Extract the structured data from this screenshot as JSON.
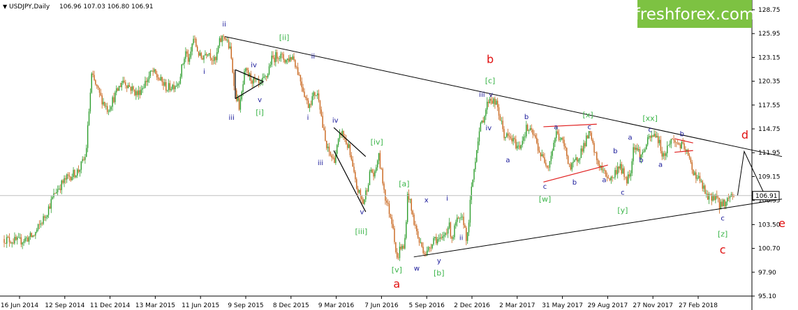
{
  "header": {
    "symbol": "USDJPY,Daily",
    "ohlc": "106.96 107.03 106.80 106.91"
  },
  "brand": {
    "logo_text": "freshforex.com",
    "bg_color": "#7dc242",
    "text_color": "#ffffff"
  },
  "colors": {
    "bull": "#2e9e2e",
    "bear": "#c8641a",
    "trend": "#000000",
    "red_line": "#e02020",
    "label_blue": "#1a1a9a",
    "label_green": "#3cb54a",
    "label_red": "#e01010",
    "current_price_bg": "#ffffff"
  },
  "chart_data": {
    "type": "candlestick",
    "ylim": [
      95.1,
      128.75
    ],
    "y_ticks": [
      "128.75",
      "125.95",
      "123.15",
      "120.35",
      "117.55",
      "114.75",
      "111.95",
      "109.15",
      "106.35",
      "103.50",
      "100.70",
      "97.90",
      "95.10"
    ],
    "x_ticks": [
      "16 Jun 2014",
      "12 Sep 2014",
      "11 Dec 2014",
      "13 Mar 2015",
      "11 Jun 2015",
      "9 Sep 2015",
      "8 Dec 2015",
      "9 Mar 2016",
      "7 Jun 2016",
      "5 Sep 2016",
      "2 Dec 2016",
      "2 Mar 2017",
      "31 May 2017",
      "29 Aug 2017",
      "27 Nov 2017",
      "27 Feb 2018"
    ],
    "current_price": 106.91,
    "current_price_label": "106.91",
    "path": [
      [
        0,
        101.8
      ],
      [
        0.02,
        101.5
      ],
      [
        0.04,
        102.2
      ],
      [
        0.055,
        104.5
      ],
      [
        0.07,
        107.5
      ],
      [
        0.085,
        109.0
      ],
      [
        0.1,
        109.8
      ],
      [
        0.11,
        111.5
      ],
      [
        0.118,
        121.0
      ],
      [
        0.13,
        118.5
      ],
      [
        0.14,
        117.0
      ],
      [
        0.16,
        120.5
      ],
      [
        0.18,
        118.8
      ],
      [
        0.2,
        121.5
      ],
      [
        0.22,
        119.5
      ],
      [
        0.235,
        120.2
      ],
      [
        0.245,
        123.8
      ],
      [
        0.25,
        122.5
      ],
      [
        0.255,
        125.5
      ],
      [
        0.265,
        123.0
      ],
      [
        0.275,
        124.0
      ],
      [
        0.285,
        122.5
      ],
      [
        0.29,
        124.8
      ],
      [
        0.297,
        125.8
      ],
      [
        0.305,
        124.0
      ],
      [
        0.312,
        119.0
      ],
      [
        0.318,
        117.2
      ],
      [
        0.325,
        121.5
      ],
      [
        0.335,
        120.5
      ],
      [
        0.345,
        119.8
      ],
      [
        0.355,
        121.0
      ],
      [
        0.36,
        122.8
      ],
      [
        0.37,
        123.5
      ],
      [
        0.38,
        122.8
      ],
      [
        0.39,
        123.3
      ],
      [
        0.4,
        120.5
      ],
      [
        0.41,
        117.5
      ],
      [
        0.42,
        119.0
      ],
      [
        0.425,
        118.5
      ],
      [
        0.43,
        115.0
      ],
      [
        0.435,
        112.5
      ],
      [
        0.445,
        111.0
      ],
      [
        0.455,
        114.5
      ],
      [
        0.465,
        112.5
      ],
      [
        0.475,
        108.0
      ],
      [
        0.485,
        106.0
      ],
      [
        0.495,
        110.0
      ],
      [
        0.5,
        109.0
      ],
      [
        0.505,
        111.8
      ],
      [
        0.515,
        106.5
      ],
      [
        0.525,
        103.5
      ],
      [
        0.53,
        99.2
      ],
      [
        0.535,
        101.0
      ],
      [
        0.54,
        100.5
      ],
      [
        0.545,
        107.5
      ],
      [
        0.55,
        105.0
      ],
      [
        0.56,
        101.5
      ],
      [
        0.57,
        100.0
      ],
      [
        0.58,
        102.0
      ],
      [
        0.59,
        101.5
      ],
      [
        0.6,
        103.5
      ],
      [
        0.605,
        101.8
      ],
      [
        0.61,
        103.8
      ],
      [
        0.62,
        104.0
      ],
      [
        0.625,
        101.5
      ],
      [
        0.63,
        107.0
      ],
      [
        0.64,
        114.0
      ],
      [
        0.655,
        118.5
      ],
      [
        0.665,
        117.5
      ],
      [
        0.675,
        114.0
      ],
      [
        0.685,
        113.5
      ],
      [
        0.695,
        112.5
      ],
      [
        0.705,
        114.8
      ],
      [
        0.715,
        114.0
      ],
      [
        0.725,
        111.5
      ],
      [
        0.735,
        110.5
      ],
      [
        0.745,
        114.3
      ],
      [
        0.755,
        113.0
      ],
      [
        0.765,
        110.0
      ],
      [
        0.775,
        111.5
      ],
      [
        0.79,
        114.2
      ],
      [
        0.8,
        111.0
      ],
      [
        0.81,
        109.5
      ],
      [
        0.82,
        108.8
      ],
      [
        0.83,
        110.5
      ],
      [
        0.84,
        108.8
      ],
      [
        0.845,
        109.5
      ],
      [
        0.85,
        113.0
      ],
      [
        0.86,
        111.5
      ],
      [
        0.87,
        113.5
      ],
      [
        0.88,
        114.2
      ],
      [
        0.89,
        111.5
      ],
      [
        0.9,
        113.5
      ],
      [
        0.91,
        113.0
      ],
      [
        0.92,
        112.3
      ],
      [
        0.93,
        109.8
      ],
      [
        0.94,
        108.5
      ],
      [
        0.95,
        106.5
      ],
      [
        0.96,
        107.0
      ],
      [
        0.965,
        105.8
      ],
      [
        0.975,
        106.2
      ],
      [
        0.98,
        107.0
      ],
      [
        0.985,
        106.91
      ]
    ],
    "projection": [
      [
        0.99,
        106.9
      ],
      [
        0.999,
        112.1
      ],
      [
        1.03,
        106.4
      ]
    ],
    "triangle_lines": [
      {
        "from": [
          0.298,
          125.6
        ],
        "to": [
          1.05,
          111.5
        ]
      },
      {
        "from": [
          0.553,
          99.7
        ],
        "to": [
          1.05,
          106.5
        ]
      }
    ],
    "small_triangles": [
      {
        "color": "#000000",
        "lines": [
          [
            [
              0.312,
              121.7
            ],
            [
              0.35,
              120.3
            ]
          ],
          [
            [
              0.312,
              118.3
            ],
            [
              0.35,
              120.3
            ]
          ],
          [
            [
              0.312,
              121.7
            ],
            [
              0.312,
              118.3
            ]
          ]
        ]
      },
      {
        "color": "#000000",
        "lines": [
          [
            [
              0.445,
              114.9
            ],
            [
              0.488,
              111.5
            ]
          ],
          [
            [
              0.445,
              112.2
            ],
            [
              0.488,
              105.0
            ]
          ]
        ]
      },
      {
        "color": "#e02020",
        "lines": [
          [
            [
              0.728,
              115.0
            ],
            [
              0.8,
              115.3
            ]
          ],
          [
            [
              0.728,
              108.5
            ],
            [
              0.815,
              110.5
            ]
          ]
        ]
      },
      {
        "color": "#e02020",
        "lines": [
          [
            [
              0.905,
              113.6
            ],
            [
              0.93,
              113.1
            ]
          ],
          [
            [
              0.905,
              112.0
            ],
            [
              0.93,
              112.2
            ]
          ]
        ]
      }
    ],
    "wave_labels": [
      {
        "t": "ii",
        "x": 0.297,
        "y": 126.8,
        "c": "label_blue",
        "s": 10
      },
      {
        "t": "i",
        "x": 0.27,
        "y": 121.2,
        "c": "label_blue",
        "s": 10
      },
      {
        "t": "iii",
        "x": 0.307,
        "y": 115.8,
        "c": "label_blue",
        "s": 10
      },
      {
        "t": "iv",
        "x": 0.337,
        "y": 122.0,
        "c": "label_blue",
        "s": 10
      },
      {
        "t": "v",
        "x": 0.345,
        "y": 117.9,
        "c": "label_blue",
        "s": 10
      },
      {
        "t": "[i]",
        "x": 0.345,
        "y": 116.4,
        "c": "label_green",
        "s": 11
      },
      {
        "t": "[ii]",
        "x": 0.378,
        "y": 125.2,
        "c": "label_green",
        "s": 11
      },
      {
        "t": "ii",
        "x": 0.417,
        "y": 123.0,
        "c": "label_blue",
        "s": 10
      },
      {
        "t": "i",
        "x": 0.41,
        "y": 115.8,
        "c": "label_blue",
        "s": 10
      },
      {
        "t": "iii",
        "x": 0.427,
        "y": 110.5,
        "c": "label_blue",
        "s": 10
      },
      {
        "t": "iv",
        "x": 0.447,
        "y": 115.5,
        "c": "label_blue",
        "s": 10
      },
      {
        "t": "[iv]",
        "x": 0.503,
        "y": 112.9,
        "c": "label_green",
        "s": 11
      },
      {
        "t": "v",
        "x": 0.483,
        "y": 104.7,
        "c": "label_blue",
        "s": 10
      },
      {
        "t": "[iii]",
        "x": 0.482,
        "y": 102.4,
        "c": "label_green",
        "s": 11
      },
      {
        "t": "[a]",
        "x": 0.54,
        "y": 108.0,
        "c": "label_green",
        "s": 11
      },
      {
        "t": "[v]",
        "x": 0.53,
        "y": 97.9,
        "c": "label_green",
        "s": 11
      },
      {
        "t": "a",
        "x": 0.53,
        "y": 96.1,
        "c": "label_red",
        "s": 16
      },
      {
        "t": "x",
        "x": 0.57,
        "y": 106.1,
        "c": "label_blue",
        "s": 10
      },
      {
        "t": "w",
        "x": 0.557,
        "y": 98.1,
        "c": "label_blue",
        "s": 10
      },
      {
        "t": "i",
        "x": 0.598,
        "y": 106.3,
        "c": "label_blue",
        "s": 10
      },
      {
        "t": "y",
        "x": 0.587,
        "y": 99.0,
        "c": "label_blue",
        "s": 10
      },
      {
        "t": "[b]",
        "x": 0.587,
        "y": 97.5,
        "c": "label_green",
        "s": 11
      },
      {
        "t": "ii",
        "x": 0.617,
        "y": 101.7,
        "c": "label_blue",
        "s": 10
      },
      {
        "t": "b",
        "x": 0.656,
        "y": 122.5,
        "c": "label_red",
        "s": 16
      },
      {
        "t": "[c]",
        "x": 0.656,
        "y": 120.1,
        "c": "label_green",
        "s": 11
      },
      {
        "t": "iii",
        "x": 0.645,
        "y": 118.5,
        "c": "label_blue",
        "s": 10
      },
      {
        "t": "v",
        "x": 0.657,
        "y": 118.5,
        "c": "label_blue",
        "s": 10
      },
      {
        "t": "iv",
        "x": 0.654,
        "y": 114.6,
        "c": "label_blue",
        "s": 10
      },
      {
        "t": "b",
        "x": 0.705,
        "y": 115.9,
        "c": "label_blue",
        "s": 10
      },
      {
        "t": "a",
        "x": 0.68,
        "y": 110.8,
        "c": "label_blue",
        "s": 10
      },
      {
        "t": "a",
        "x": 0.745,
        "y": 114.7,
        "c": "label_blue",
        "s": 10
      },
      {
        "t": "c",
        "x": 0.73,
        "y": 107.7,
        "c": "label_blue",
        "s": 10
      },
      {
        "t": "[w]",
        "x": 0.73,
        "y": 106.2,
        "c": "label_green",
        "s": 11
      },
      {
        "t": "b",
        "x": 0.77,
        "y": 108.2,
        "c": "label_blue",
        "s": 10
      },
      {
        "t": "[x]",
        "x": 0.788,
        "y": 116.1,
        "c": "label_green",
        "s": 11
      },
      {
        "t": "c",
        "x": 0.79,
        "y": 114.7,
        "c": "label_blue",
        "s": 10
      },
      {
        "t": "a",
        "x": 0.81,
        "y": 108.5,
        "c": "label_blue",
        "s": 10
      },
      {
        "t": "b",
        "x": 0.825,
        "y": 111.9,
        "c": "label_blue",
        "s": 10
      },
      {
        "t": "c",
        "x": 0.835,
        "y": 107.0,
        "c": "label_blue",
        "s": 10
      },
      {
        "t": "[y]",
        "x": 0.835,
        "y": 104.9,
        "c": "label_green",
        "s": 11
      },
      {
        "t": "a",
        "x": 0.845,
        "y": 113.5,
        "c": "label_blue",
        "s": 10
      },
      {
        "t": "b",
        "x": 0.86,
        "y": 110.8,
        "c": "label_blue",
        "s": 10
      },
      {
        "t": "[xx]",
        "x": 0.872,
        "y": 115.7,
        "c": "label_green",
        "s": 11
      },
      {
        "t": "c",
        "x": 0.872,
        "y": 114.4,
        "c": "label_blue",
        "s": 10
      },
      {
        "t": "b",
        "x": 0.915,
        "y": 113.9,
        "c": "label_blue",
        "s": 10
      },
      {
        "t": "a",
        "x": 0.886,
        "y": 110.3,
        "c": "label_blue",
        "s": 10
      },
      {
        "t": "d",
        "x": 1.0,
        "y": 113.6,
        "c": "label_red",
        "s": 16
      },
      {
        "t": "c",
        "x": 0.97,
        "y": 104.0,
        "c": "label_blue",
        "s": 10
      },
      {
        "t": "[z]",
        "x": 0.97,
        "y": 102.1,
        "c": "label_green",
        "s": 11
      },
      {
        "t": "c",
        "x": 0.97,
        "y": 100.1,
        "c": "label_red",
        "s": 16
      },
      {
        "t": "e",
        "x": 1.05,
        "y": 103.2,
        "c": "label_red",
        "s": 16
      }
    ]
  }
}
